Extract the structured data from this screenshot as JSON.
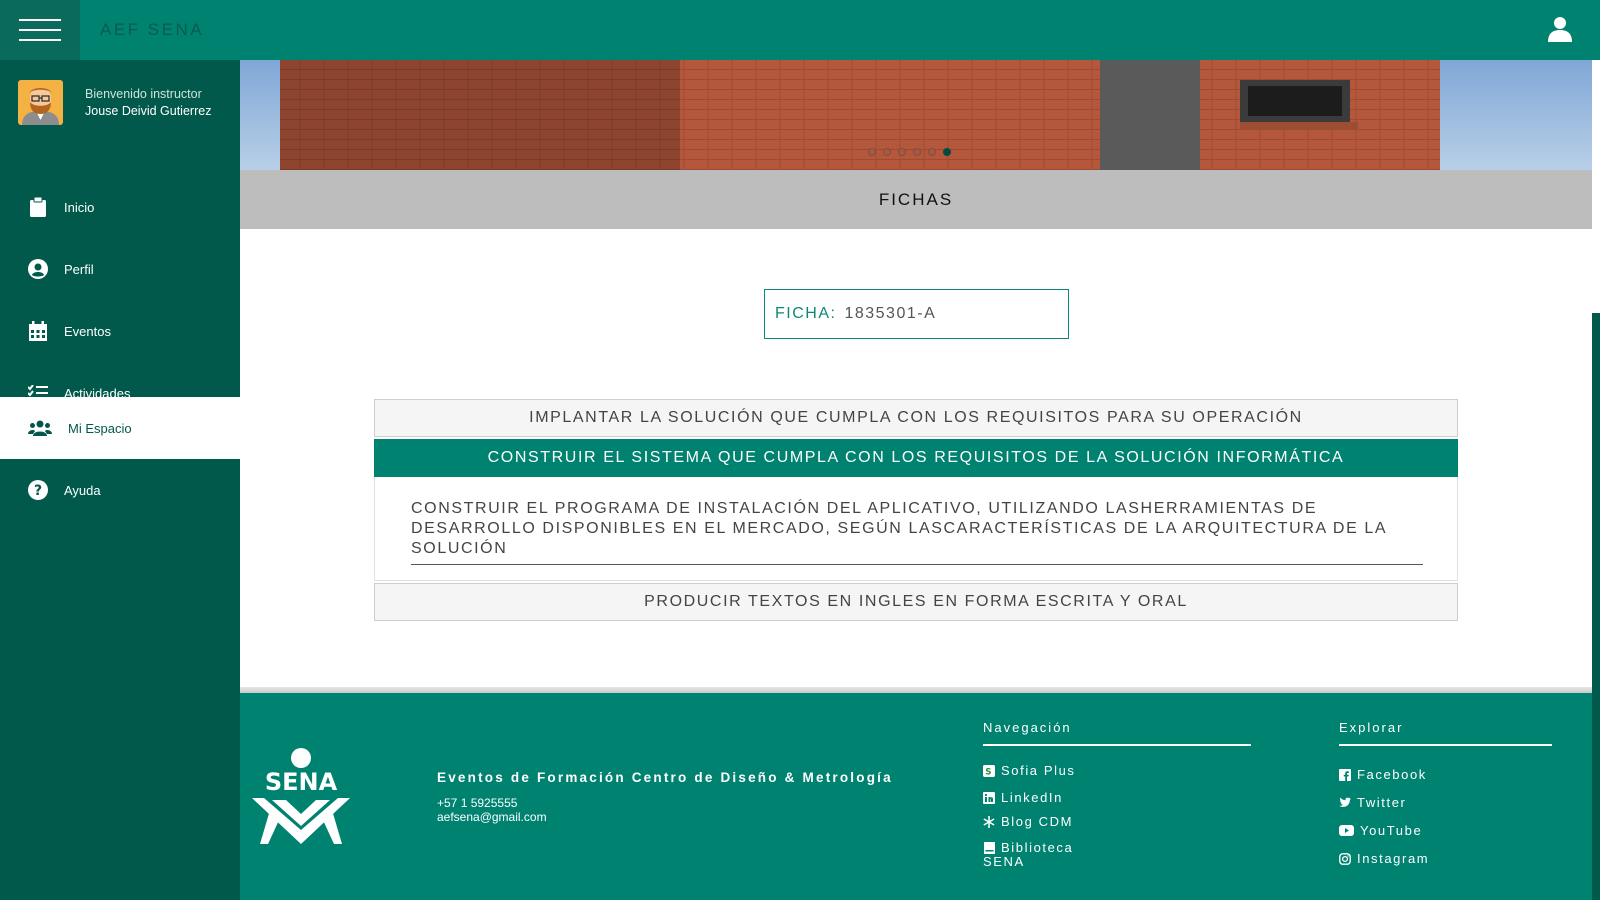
{
  "app": {
    "title": "AEF SENA"
  },
  "profile": {
    "welcome": "Bienvenido instructor",
    "name": "Jouse Deivid Gutierrez"
  },
  "sidebar": {
    "items": [
      {
        "label": "Inicio",
        "icon": "clipboard-icon"
      },
      {
        "label": "Perfil",
        "icon": "user-circle-icon"
      },
      {
        "label": "Eventos",
        "icon": "calendar-icon"
      },
      {
        "label": "Actividades",
        "icon": "tasks-icon"
      },
      {
        "label": "Mi Espacio",
        "icon": "users-icon",
        "active": true
      },
      {
        "label": "Ayuda",
        "icon": "question-circle-icon"
      }
    ]
  },
  "carousel": {
    "slides": 6,
    "active_index": 5
  },
  "section": {
    "title": "FICHAS"
  },
  "ficha": {
    "label": "FICHA:",
    "value": "1835301-A"
  },
  "accordion": {
    "items": [
      {
        "title": "IMPLANTAR LA SOLUCIÓN QUE CUMPLA CON LOS REQUISITOS PARA SU OPERACIÓN"
      },
      {
        "title": "CONSTRUIR EL SISTEMA QUE CUMPLA CON LOS REQUISITOS DE LA SOLUCIÓN INFORMÁTICA",
        "expanded": true,
        "content": "CONSTRUIR EL PROGRAMA DE INSTALACIÓN DEL APLICATIVO, UTILIZANDO LASHERRAMIENTAS DE DESARROLLO DISPONIBLES EN EL MERCADO, SEGÚN LASCARACTERÍSTICAS DE LA ARQUITECTURA DE LA SOLUCIÓN"
      },
      {
        "title": "PRODUCIR TEXTOS EN INGLES EN FORMA ESCRITA Y ORAL"
      }
    ]
  },
  "footer": {
    "logo_text": "SENA",
    "title": "Eventos de Formación Centro de Diseño & Metrología",
    "phone": "+57 1 5925555",
    "email": "aefsena@gmail.com",
    "nav_title": "Navegación",
    "nav_links": [
      "Sofia Plus",
      "LinkedIn",
      "Blog CDM",
      "Biblioteca",
      "SENA"
    ],
    "explore_title": "Explorar",
    "explore_links": [
      "Facebook",
      "Twitter",
      "YouTube",
      "Instagram"
    ]
  },
  "colors": {
    "primary": "#008270",
    "sidebar": "#00594a",
    "header_gray": "#bdbdbd"
  }
}
